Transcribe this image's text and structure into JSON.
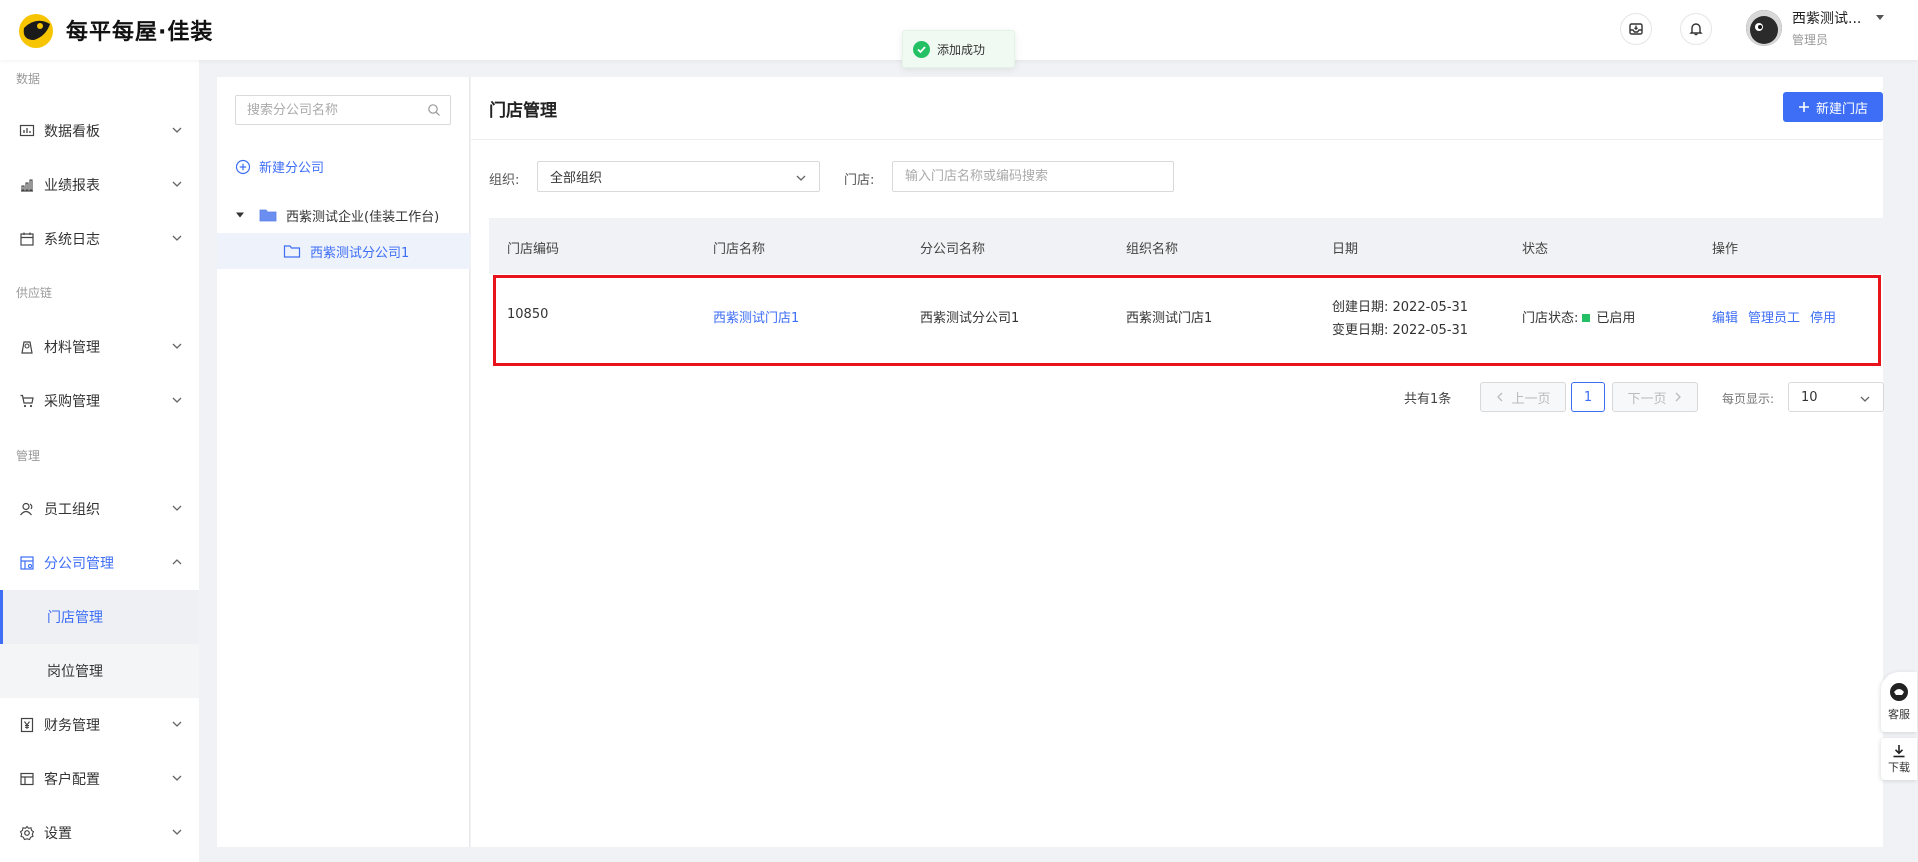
{
  "header": {
    "logo_text": "每平每屋·佳装",
    "user_name": "西紫测试...",
    "user_role": "管理员"
  },
  "toast": {
    "text": "添加成功"
  },
  "sidebar": {
    "sections": [
      {
        "label": "数据"
      },
      {
        "label": "供应链"
      },
      {
        "label": "管理"
      }
    ],
    "items": [
      {
        "label": "数据看板",
        "icon": "chart-board-icon"
      },
      {
        "label": "业绩报表",
        "icon": "bar-report-icon"
      },
      {
        "label": "系统日志",
        "icon": "calendar-log-icon"
      },
      {
        "label": "材料管理",
        "icon": "material-icon"
      },
      {
        "label": "采购管理",
        "icon": "cart-icon"
      },
      {
        "label": "员工组织",
        "icon": "people-icon"
      },
      {
        "label": "分公司管理",
        "icon": "branch-icon"
      },
      {
        "label": "财务管理",
        "icon": "yen-icon"
      },
      {
        "label": "客户配置",
        "icon": "layout-icon"
      },
      {
        "label": "设置",
        "icon": "gear-icon"
      }
    ],
    "subitems": [
      {
        "label": "门店管理"
      },
      {
        "label": "岗位管理"
      }
    ]
  },
  "tree": {
    "search_placeholder": "搜索分公司名称",
    "new_branch": "新建分公司",
    "nodes": [
      {
        "label": "西紫测试企业(佳装工作台)"
      },
      {
        "label": "西紫测试分公司1"
      }
    ]
  },
  "main": {
    "title": "门店管理",
    "new_store_button": "新建门店",
    "filters": {
      "org_label": "组织:",
      "org_value": "全部组织",
      "store_label": "门店:",
      "store_placeholder": "输入门店名称或编码搜索"
    },
    "table": {
      "columns": [
        "门店编码",
        "门店名称",
        "分公司名称",
        "组织名称",
        "日期",
        "状态",
        "操作"
      ],
      "rows": [
        {
          "code": "10850",
          "store_name": "西紫测试门店1",
          "branch_name": "西紫测试分公司1",
          "org_name": "西紫测试门店1",
          "created": "创建日期:  2022-05-31",
          "changed": "变更日期:  2022-05-31",
          "status_label": "门店状态:",
          "status_value": "已启用",
          "status_color": "#23c164",
          "ops": [
            "编辑",
            "管理员工",
            "停用"
          ]
        }
      ]
    },
    "pagination": {
      "total": "共有1条",
      "prev": "上一页",
      "current": "1",
      "next": "下一页",
      "page_size_label": "每页显示:",
      "page_size": "10"
    }
  },
  "floating": {
    "service": "客服",
    "download": "下载"
  },
  "colors": {
    "primary": "#3d6ef5",
    "highlight_border": "#e8131b",
    "success": "#23c164"
  }
}
